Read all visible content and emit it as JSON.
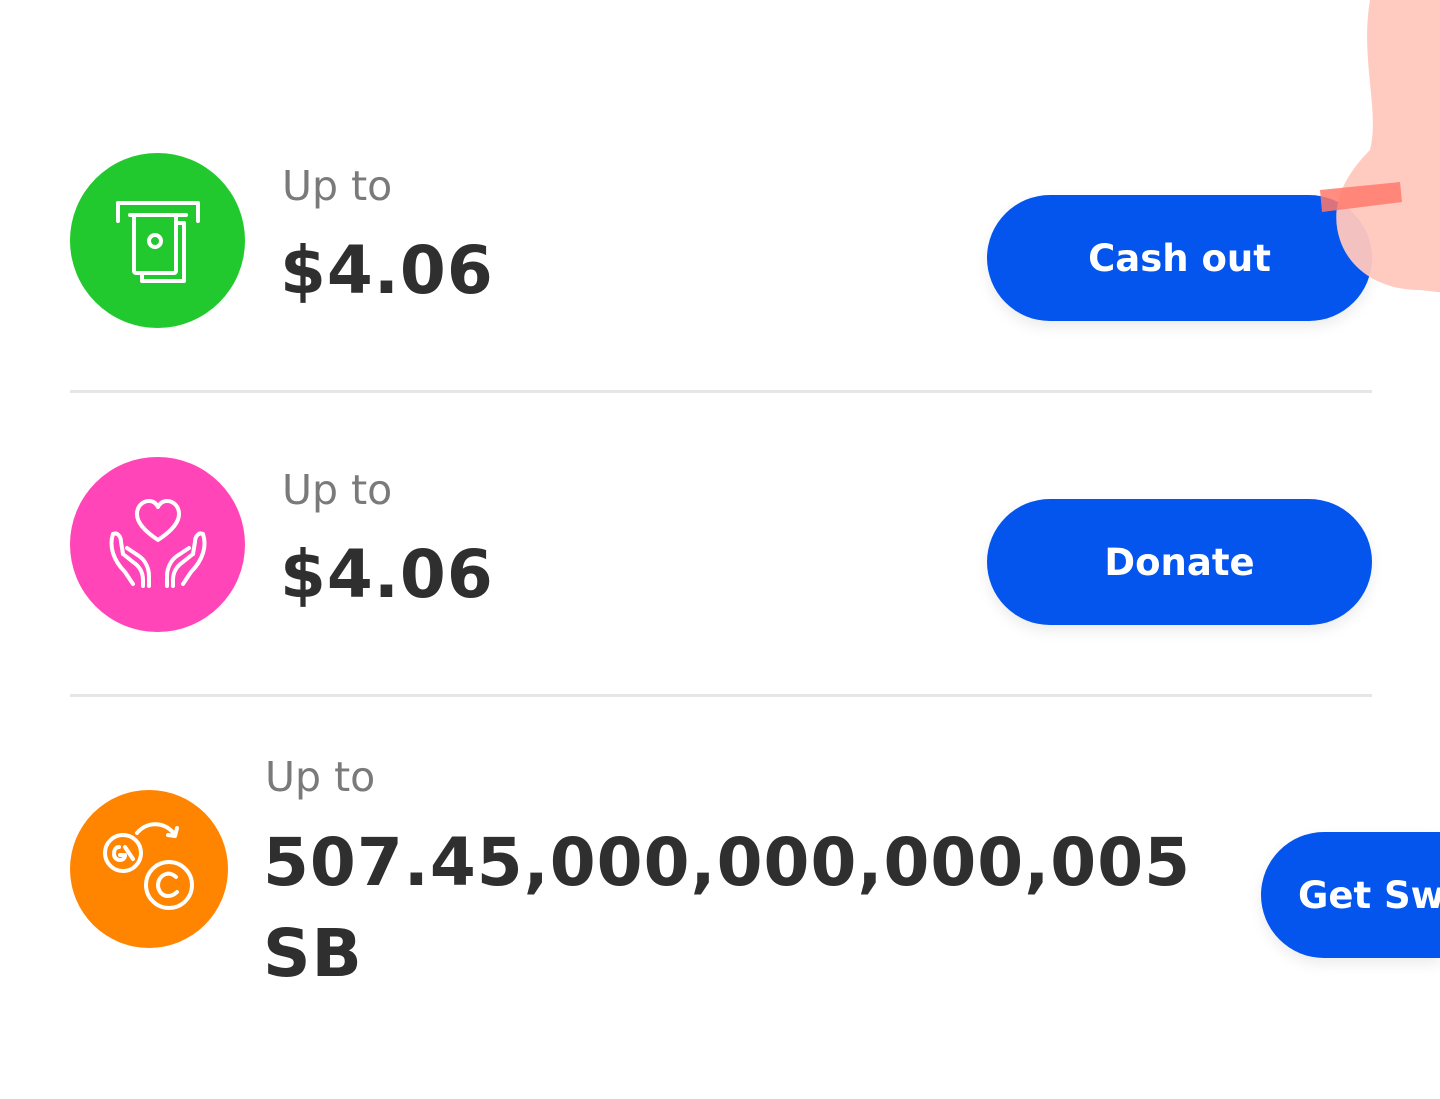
{
  "rows": [
    {
      "icon": "atm-cash-icon",
      "icon_color": "#22c92e",
      "prefix": "Up to",
      "amount": "$4.06",
      "button_label": "Cash out"
    },
    {
      "icon": "heart-hands-icon",
      "icon_color": "#ff45b8",
      "prefix": "Up to",
      "amount": "$4.06",
      "button_label": "Donate"
    },
    {
      "icon": "coin-exchange-icon",
      "icon_color": "#ff8500",
      "prefix": "Up to",
      "amount_line1": "507.45,000,000,000,005",
      "amount_line2": "SB",
      "button_label": "Get Sw"
    }
  ],
  "colors": {
    "button": "#0455ee",
    "divider": "#e6e6e6",
    "amount_text": "#2f2f2f",
    "prefix_text": "#7a7a7a"
  }
}
